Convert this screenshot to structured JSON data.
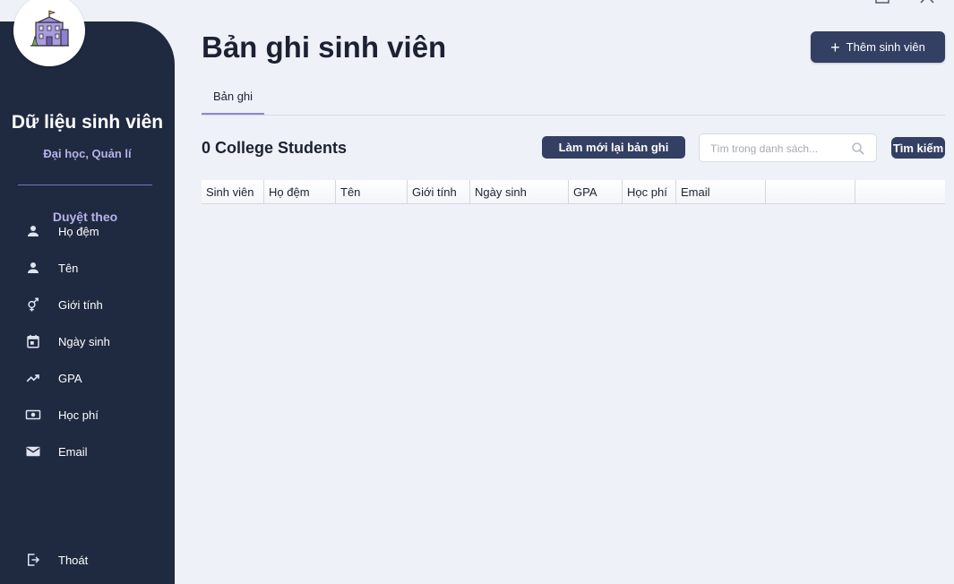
{
  "sidebar": {
    "title": "Dữ liệu sinh viên",
    "subtitle": "Đại học, Quản lí",
    "browse_label": "Duyệt theo",
    "items": [
      {
        "label": "Họ đệm",
        "icon": "person-icon"
      },
      {
        "label": "Tên",
        "icon": "person-icon"
      },
      {
        "label": "Giới tính",
        "icon": "gender-icon"
      },
      {
        "label": "Ngày sinh",
        "icon": "calendar-icon"
      },
      {
        "label": "GPA",
        "icon": "trending-up-icon"
      },
      {
        "label": "Học phí",
        "icon": "money-icon"
      },
      {
        "label": "Email",
        "icon": "mail-icon"
      }
    ],
    "logout_label": "Thoát",
    "colors": {
      "bg": "#1f2940",
      "accent": "#b7b2ea",
      "divider": "#7c74c4"
    }
  },
  "header": {
    "title": "Bản ghi sinh viên",
    "add_button": "Thêm sinh viên"
  },
  "tabs": [
    {
      "label": "Bản ghi",
      "active": true
    }
  ],
  "toolbar": {
    "count_text": "0 College Students",
    "refresh_button": "Làm mới lại bản ghi",
    "search_placeholder": "Tìm trong danh sách...",
    "search_button": "Tìm kiếm"
  },
  "table": {
    "columns": [
      "Sinh viên",
      "Họ đệm",
      "Tên",
      "Giới tính",
      "Ngày sinh",
      "GPA",
      "Học phí",
      "Email",
      "",
      ""
    ],
    "rows": []
  },
  "colors": {
    "button_bg": "#333f63",
    "page_bg": "#eef1f7",
    "tab_underline": "#8d86d6"
  }
}
